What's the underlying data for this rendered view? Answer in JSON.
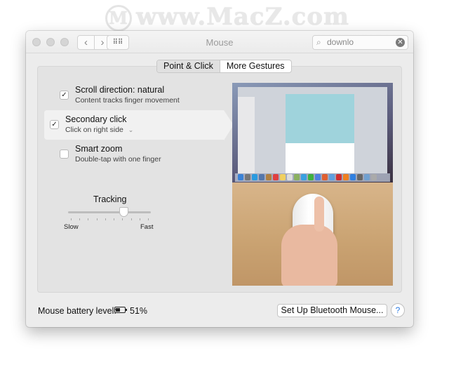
{
  "watermark": "www.MacZ.com",
  "window": {
    "title": "Mouse"
  },
  "search": {
    "value": "downlo"
  },
  "tabs": [
    {
      "label": "Point & Click",
      "selected": true
    },
    {
      "label": "More Gestures",
      "selected": false
    }
  ],
  "options": [
    {
      "label": "Scroll direction: natural",
      "sub": "Content tracks finger movement",
      "checked": true
    },
    {
      "label": "Secondary click",
      "sub": "Click on right side",
      "checked": true,
      "has_dropdown": true
    },
    {
      "label": "Smart zoom",
      "sub": "Double-tap with one finger",
      "checked": false
    }
  ],
  "tracking": {
    "label": "Tracking",
    "min_label": "Slow",
    "max_label": "Fast",
    "value": 0.667,
    "ticks": 10
  },
  "battery": {
    "label": "Mouse battery level:",
    "value": "51%",
    "level": 51
  },
  "setup_button": "Set Up Bluetooth Mouse...",
  "help": "?"
}
